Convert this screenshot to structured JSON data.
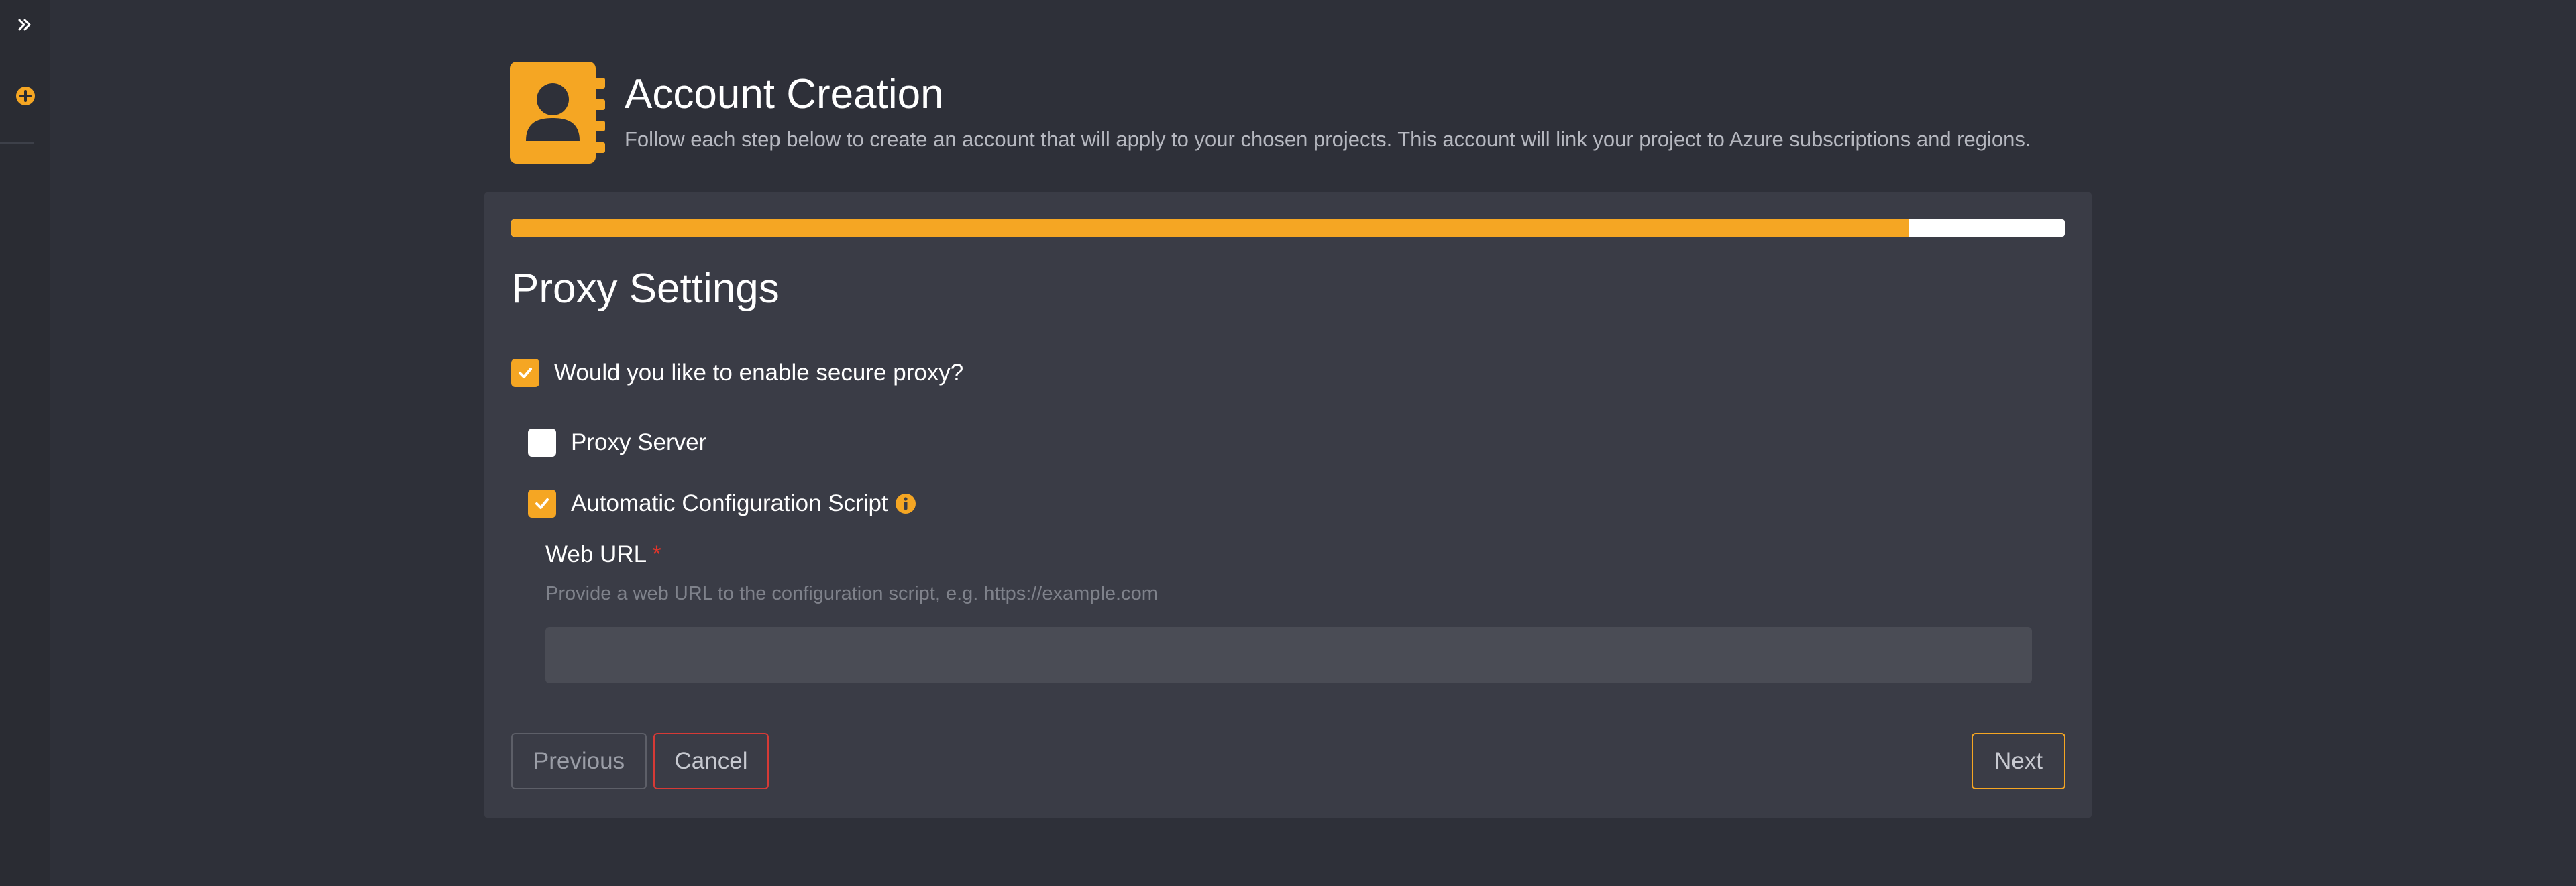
{
  "header": {
    "title": "Account Creation",
    "subtitle": "Follow each step below to create an account that will apply to your chosen projects. This account will link your project to Azure subscriptions and regions.",
    "icon": "contact-book-icon"
  },
  "sidebar": {
    "expand_icon": "double-chevron-right-icon",
    "add_icon": "plus-circle-icon"
  },
  "wizard": {
    "progress_fraction": 0.9,
    "section_title": "Proxy Settings",
    "enable_proxy": {
      "label": "Would you like to enable secure proxy?",
      "checked": true
    },
    "proxy_server": {
      "label": "Proxy Server",
      "checked": false
    },
    "auto_config": {
      "label": "Automatic Configuration Script",
      "checked": true,
      "info_icon": "info-circle-icon"
    },
    "web_url": {
      "label": "Web URL",
      "required_mark": "*",
      "help": "Provide a web URL to the configuration script, e.g. https://example.com",
      "value": ""
    },
    "buttons": {
      "previous": "Previous",
      "cancel": "Cancel",
      "next": "Next"
    }
  },
  "colors": {
    "accent": "#f5a623",
    "background": "#2e3039",
    "card": "#3a3c46",
    "danger": "#d63a36"
  }
}
